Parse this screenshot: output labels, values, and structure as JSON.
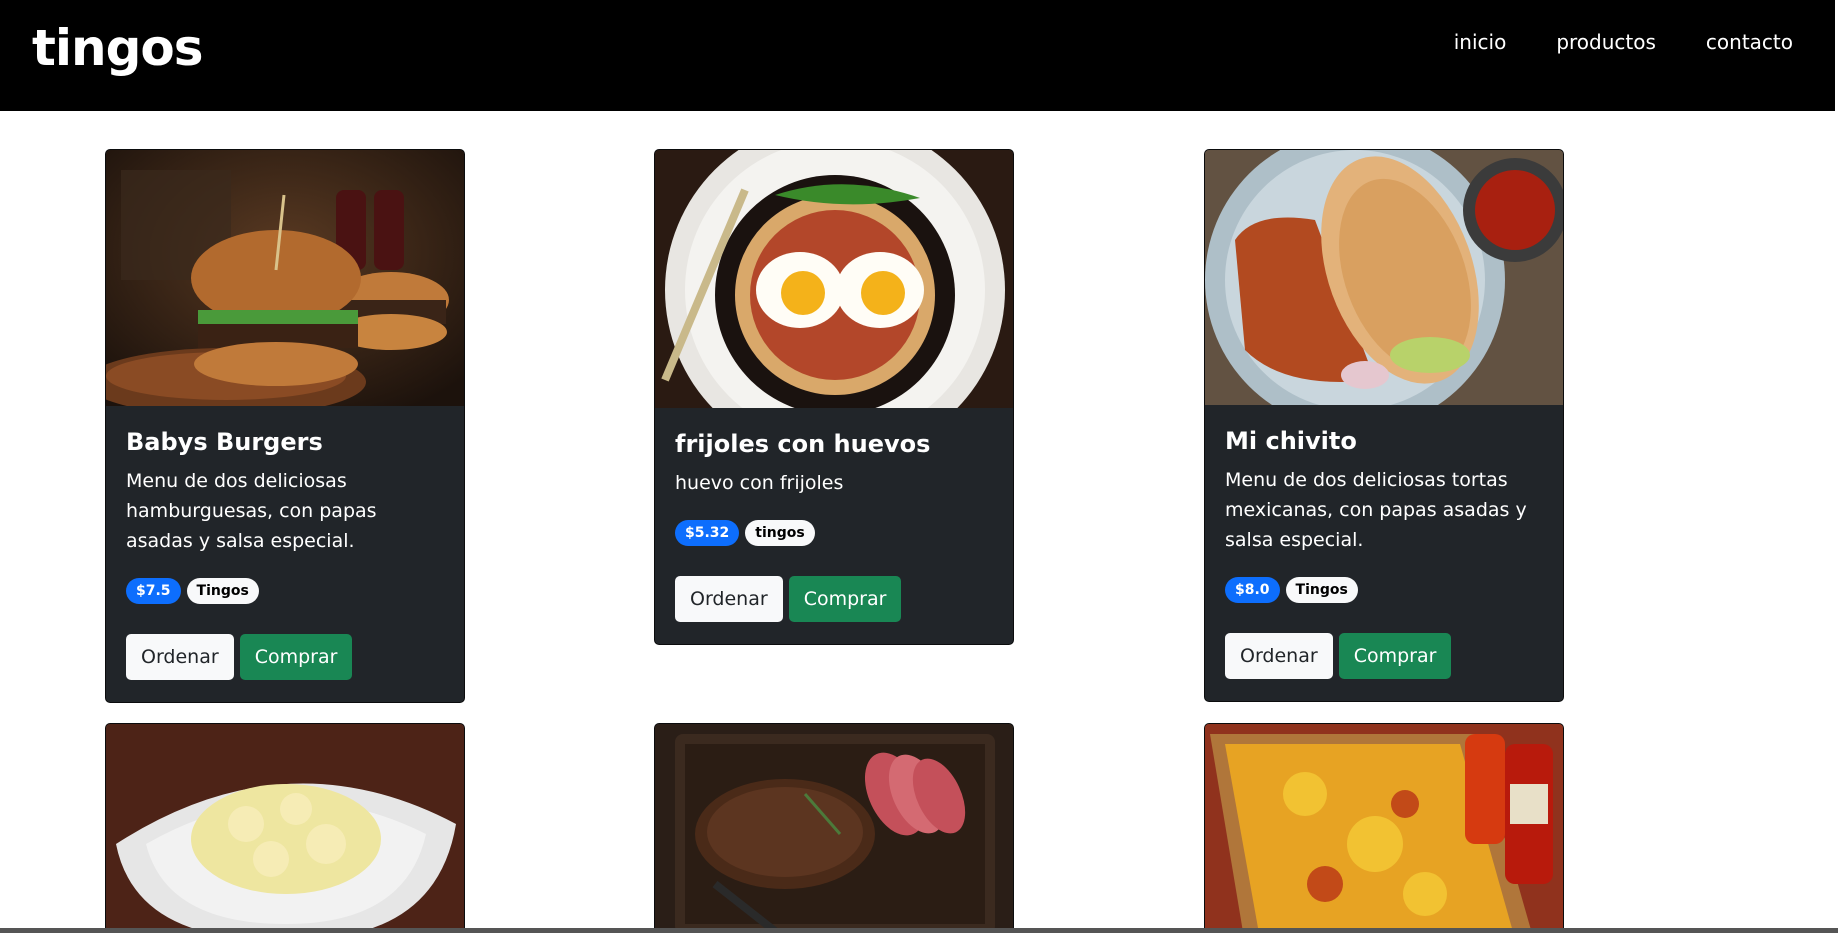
{
  "nav": {
    "brand": "tingos",
    "links": [
      "inicio",
      "productos",
      "contacto"
    ]
  },
  "cards": [
    {
      "title": "Babys Burgers",
      "text": "Menu de dos deliciosas hamburguesas, con papas asadas y salsa especial.",
      "price": "$7.5",
      "store": "Tingos",
      "order_label": "Ordenar",
      "buy_label": "Comprar",
      "image": "burger"
    },
    {
      "title": "frijoles con huevos",
      "text": "huevo con frijoles",
      "price": "$5.32",
      "store": "tingos",
      "order_label": "Ordenar",
      "buy_label": "Comprar",
      "image": "eggs"
    },
    {
      "title": "Mi chivito",
      "text": "Menu de dos deliciosas tortas mexicanas, con papas asadas y salsa especial.",
      "price": "$8.0",
      "store": "Tingos",
      "order_label": "Ordenar",
      "buy_label": "Comprar",
      "image": "torta"
    }
  ],
  "colors": {
    "navbar": "#000000",
    "card": "#212529",
    "price_badge": "#0d6efd",
    "buy_button": "#198754"
  }
}
